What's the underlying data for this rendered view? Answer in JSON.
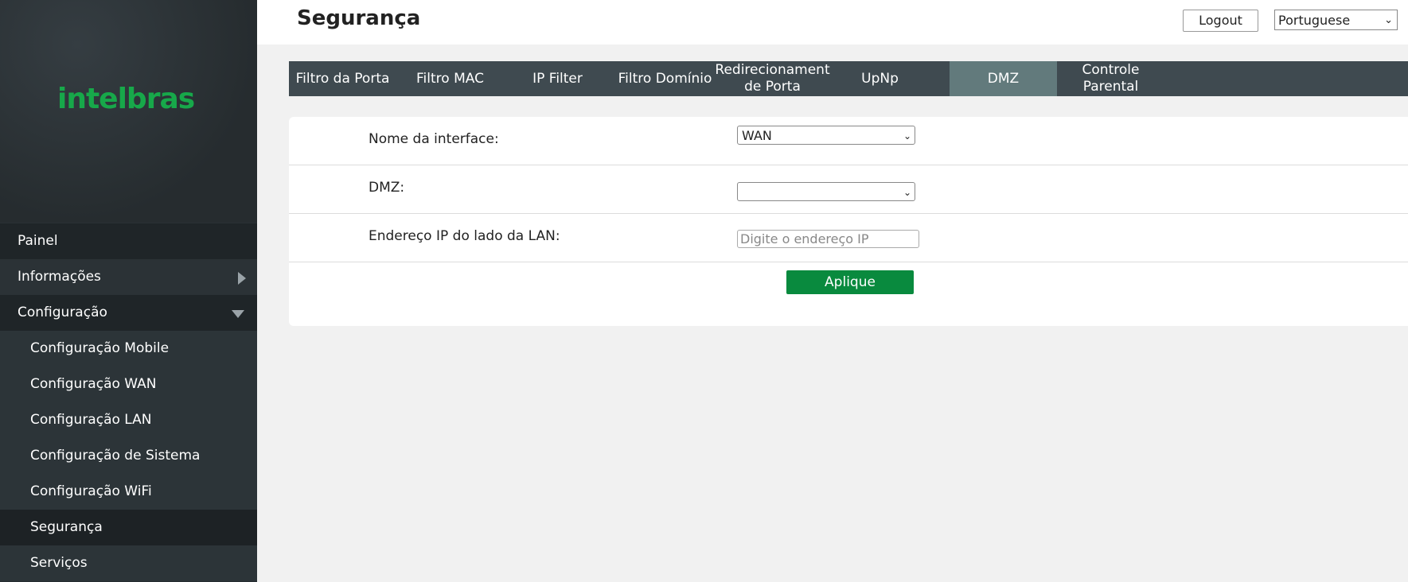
{
  "brand": {
    "logo_text": "intelbras",
    "accent": "#17a84a"
  },
  "header": {
    "title": "Segurança",
    "logout_label": "Logout",
    "language_selected": "Portuguese"
  },
  "sidebar": {
    "items": [
      {
        "label": "Painel"
      },
      {
        "label": "Informações"
      },
      {
        "label": "Configuração"
      },
      {
        "label": "Configuração Mobile"
      },
      {
        "label": "Configuração WAN"
      },
      {
        "label": "Configuração LAN"
      },
      {
        "label": "Configuração de Sistema"
      },
      {
        "label": "Configuração WiFi"
      },
      {
        "label": "Segurança"
      },
      {
        "label": "Serviços"
      }
    ]
  },
  "tabs": [
    {
      "label": "Filtro da Porta"
    },
    {
      "label": "Filtro MAC"
    },
    {
      "label": "IP Filter"
    },
    {
      "label": "Filtro Domínio"
    },
    {
      "label": "Redirecionament de Porta"
    },
    {
      "label": "UpNp"
    },
    {
      "label": "DMZ"
    },
    {
      "label": "Controle Parental"
    }
  ],
  "form": {
    "interface_label": "Nome da interface:",
    "interface_value": "WAN",
    "dmz_label": "DMZ:",
    "dmz_value": "",
    "lan_ip_label": "Endereço IP do lado da LAN:",
    "lan_ip_placeholder": "Digite o endereço IP",
    "apply_label": "Aplique"
  }
}
